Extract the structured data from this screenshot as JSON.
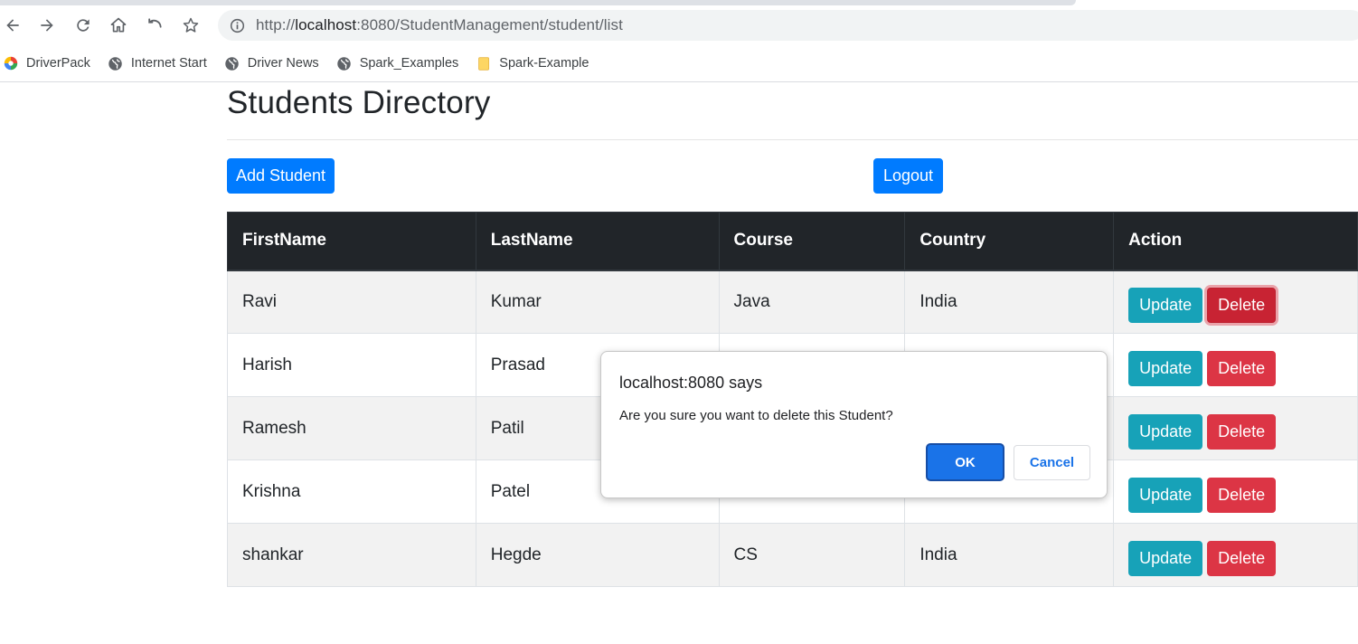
{
  "browser": {
    "url_prefix": "http://",
    "url_host": "localhost",
    "url_rest": ":8080/StudentManagement/student/list",
    "bookmarks": [
      {
        "label": "DriverPack",
        "icon": "driverpack-icon"
      },
      {
        "label": "Internet Start",
        "icon": "globe-icon"
      },
      {
        "label": "Driver News",
        "icon": "globe-icon"
      },
      {
        "label": "Spark_Examples",
        "icon": "globe-icon"
      },
      {
        "label": "Spark-Example",
        "icon": "folder-icon"
      }
    ]
  },
  "page": {
    "title": "Students Directory",
    "add_button": "Add Student",
    "logout_button": "Logout"
  },
  "table": {
    "headers": [
      "FirstName",
      "LastName",
      "Course",
      "Country",
      "Action"
    ],
    "rows": [
      {
        "first": "Ravi",
        "last": "Kumar",
        "course": "Java",
        "country": "India"
      },
      {
        "first": "Harish",
        "last": "Prasad",
        "course": "",
        "country": ""
      },
      {
        "first": "Ramesh",
        "last": "Patil",
        "course": "",
        "country": ""
      },
      {
        "first": "Krishna",
        "last": "Patel",
        "course": "",
        "country": ""
      },
      {
        "first": "shankar",
        "last": "Hegde",
        "course": "CS",
        "country": "India"
      }
    ],
    "update_label": "Update",
    "delete_label": "Delete"
  },
  "dialog": {
    "title": "localhost:8080 says",
    "message": "Are you sure you want to delete this Student?",
    "ok_label": "OK",
    "cancel_label": "Cancel"
  },
  "colors": {
    "primary": "#007bff",
    "info": "#17a2b8",
    "danger": "#dc3545",
    "dark": "#212529",
    "dialog_blue": "#1a73e8"
  }
}
